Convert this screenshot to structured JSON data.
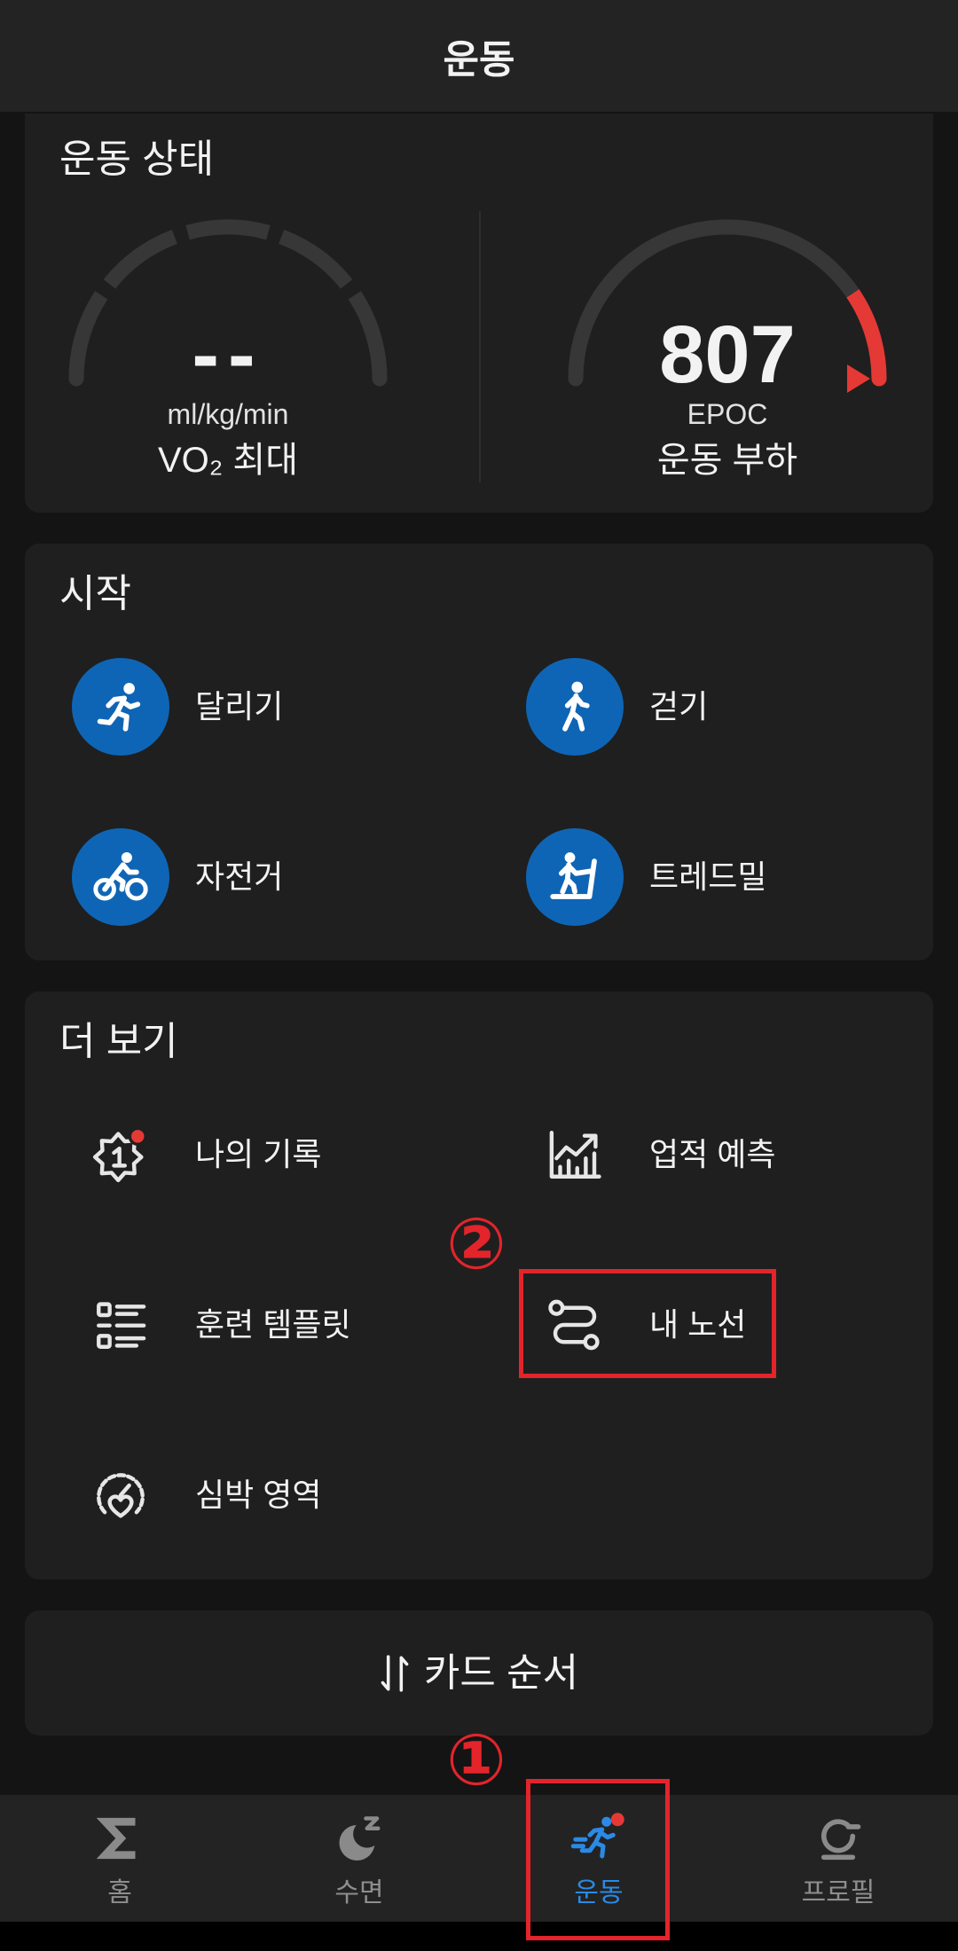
{
  "header": {
    "title": "운동"
  },
  "status": {
    "title": "운동 상태",
    "vo2max": {
      "value": "--",
      "unit": "ml/kg/min",
      "label": "VO₂ 최대"
    },
    "training_load": {
      "value": "807",
      "unit": "EPOC",
      "label": "운동 부하",
      "gauge_level": 1.0,
      "high_zone_from": 0.81
    }
  },
  "start": {
    "title": "시작",
    "items": [
      {
        "label": "달리기",
        "icon": "running-icon"
      },
      {
        "label": "걷기",
        "icon": "walking-icon"
      },
      {
        "label": "자전거",
        "icon": "cycling-icon"
      },
      {
        "label": "트레드밀",
        "icon": "treadmill-icon"
      }
    ]
  },
  "more": {
    "title": "더 보기",
    "items": [
      {
        "label": "나의 기록",
        "icon": "personal-record-badge-icon",
        "notification_dot": true
      },
      {
        "label": "업적 예측",
        "icon": "performance-forecast-chart-icon"
      },
      {
        "label": "훈련 템플릿",
        "icon": "workout-template-list-icon"
      },
      {
        "label": "내 노선",
        "icon": "route-icon"
      },
      {
        "label": "심박 영역",
        "icon": "heart-rate-zone-icon"
      }
    ]
  },
  "card_order": {
    "label": "카드 순서",
    "icon": "sort-arrows-icon"
  },
  "nav": {
    "items": [
      {
        "label": "홈",
        "icon": "home-sigma-icon",
        "active": false
      },
      {
        "label": "수면",
        "icon": "sleep-moon-icon",
        "active": false
      },
      {
        "label": "운동",
        "icon": "exercise-running-icon",
        "active": true,
        "notification_dot": true
      },
      {
        "label": "프로필",
        "icon": "profile-icon",
        "active": false
      }
    ]
  },
  "annotations": [
    {
      "label": "①"
    },
    {
      "label": "②"
    }
  ],
  "colors": {
    "background": "#141414",
    "card": "#1f1f1f",
    "bar": "#232323",
    "text": "#f2f2f2",
    "muted": "#8e8e8e",
    "icon_stroke": "#e6e6e6",
    "activity_blue": "#0f65b5",
    "nav_active_blue": "#2a8ae6",
    "gauge_track": "#373737",
    "alert_red": "#e53935",
    "annotation_red": "#e3242b"
  }
}
